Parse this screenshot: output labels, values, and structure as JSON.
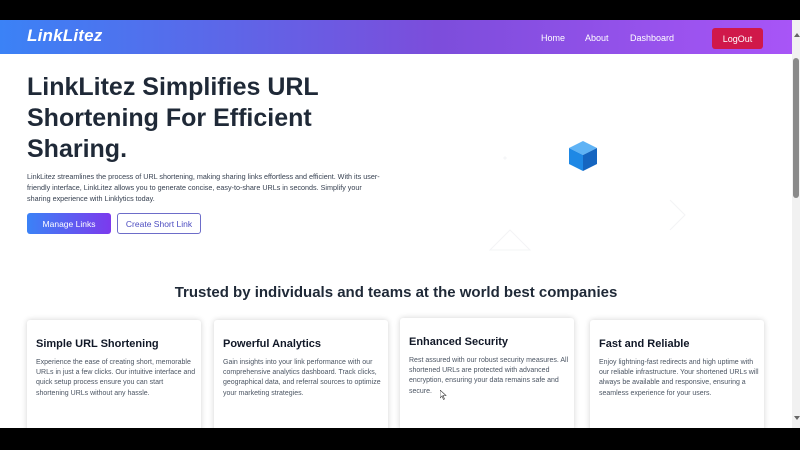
{
  "navbar": {
    "logo": "LinkLitez",
    "links": [
      "Home",
      "About",
      "Dashboard"
    ],
    "logout_label": "LogOut"
  },
  "hero": {
    "title": "LinkLitez Simplifies URL Shortening For Efficient Sharing.",
    "description": "LinkLitez streamlines the process of URL shortening, making sharing links effortless and efficient. With its user-friendly interface, LinkLitez allows you to generate concise, easy-to-share URLs in seconds. Simplify your sharing experience with Linklytics today.",
    "primary_button": "Manage Links",
    "secondary_button": "Create Short Link"
  },
  "trusted": {
    "title": "Trusted by individuals and teams at the world best companies"
  },
  "features": [
    {
      "title": "Simple URL Shortening",
      "text": "Experience the ease of creating short, memorable URLs in just a few clicks. Our intuitive interface and quick setup process ensure you can start shortening URLs without any hassle."
    },
    {
      "title": "Powerful Analytics",
      "text": "Gain insights into your link performance with our comprehensive analytics dashboard. Track clicks, geographical data, and referral sources to optimize your marketing strategies."
    },
    {
      "title": "Enhanced Security",
      "text": "Rest assured with our robust security measures. All shortened URLs are protected with advanced encryption, ensuring your data remains safe and secure."
    },
    {
      "title": "Fast and Reliable",
      "text": "Enjoy lightning-fast redirects and high uptime with our reliable infrastructure. Your shortened URLs will always be available and responsive, ensuring a seamless experience for your users."
    }
  ],
  "colors": {
    "nav_gradient_start": "#3b82f6",
    "nav_gradient_end": "#a855f7",
    "logout": "#d0184a",
    "cube": "#1e88e5"
  },
  "icons": [
    "cube-icon",
    "mouse-cursor-icon"
  ]
}
